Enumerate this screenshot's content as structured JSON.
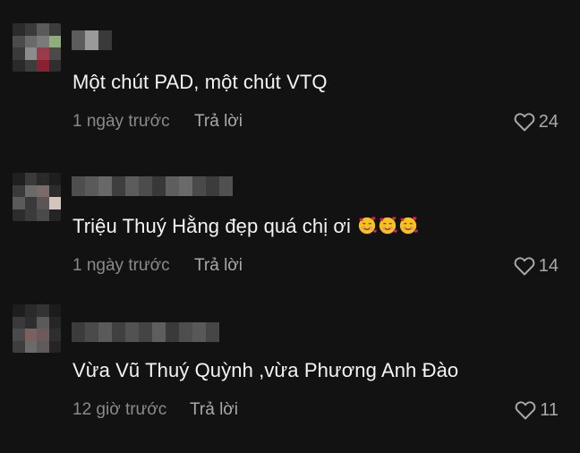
{
  "comments": [
    {
      "text": "Một chút PAD, một chút VTQ",
      "time": "1 ngày trước",
      "reply_label": "Trả lời",
      "likes": "24",
      "emojis": 0
    },
    {
      "text": "Triệu Thuý Hằng đẹp quá chị ơi",
      "time": "1 ngày trước",
      "reply_label": "Trả lời",
      "likes": "14",
      "emojis": 3,
      "emoji_name": "smiling-face-with-hearts-icon"
    },
    {
      "text": "Vừa Vũ Thuý Quỳnh ,vừa Phương Anh Đào",
      "time": "12 giờ trước",
      "reply_label": "Trả lời",
      "likes": "11",
      "emojis": 0
    }
  ],
  "colors": {
    "background": "#121212",
    "text": "#f4f4f4",
    "meta": "#8a8a8a",
    "reply": "#a9a9a9"
  },
  "icons": {
    "like": "heart-outline-icon"
  }
}
